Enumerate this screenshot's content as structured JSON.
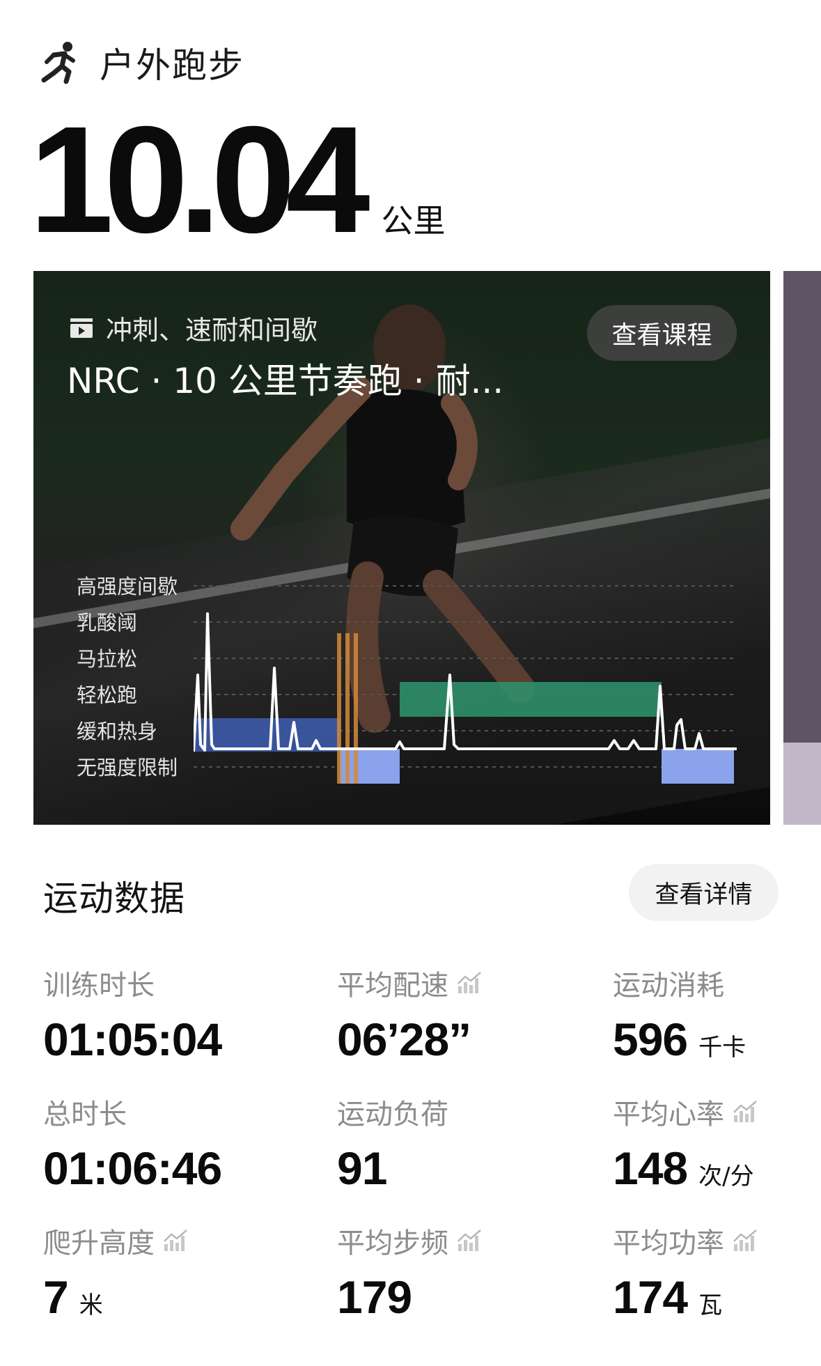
{
  "activity": {
    "icon": "running-icon",
    "title": "户外跑步"
  },
  "distance": {
    "value": "10.04",
    "unit": "公里"
  },
  "course": {
    "tag": "冲刺、速耐和间歇",
    "name": "NRC · 10 公里节奏跑 · 耐...",
    "view_button": "查看课程",
    "intensity_zones": [
      "高强度间歇",
      "乳酸阈",
      "马拉松",
      "轻松跑",
      "缓和热身",
      "无强度限制"
    ]
  },
  "stats": {
    "title": "运动数据",
    "details_button": "查看详情",
    "items": [
      {
        "label": "训练时长",
        "value": "01:05:04",
        "unit": "",
        "trend_icon": false
      },
      {
        "label": "平均配速",
        "value": "06’28”",
        "unit": "",
        "trend_icon": true
      },
      {
        "label": "运动消耗",
        "value": "596",
        "unit": "千卡",
        "trend_icon": false
      },
      {
        "label": "总时长",
        "value": "01:06:46",
        "unit": "",
        "trend_icon": false
      },
      {
        "label": "运动负荷",
        "value": "91",
        "unit": "",
        "trend_icon": false
      },
      {
        "label": "平均心率",
        "value": "148",
        "unit": "次/分",
        "trend_icon": true
      },
      {
        "label": "爬升高度",
        "value": "7",
        "unit": "米",
        "trend_icon": true
      },
      {
        "label": "平均步频",
        "value": "179",
        "unit": "",
        "trend_icon": true
      },
      {
        "label": "平均功率",
        "value": "174",
        "unit": "瓦",
        "trend_icon": true
      }
    ]
  },
  "colors": {
    "zone_blue": "#5b7fd9",
    "zone_green": "#2f8f6a",
    "zone_orange": "#d38a3a",
    "card_bg": "#1b2a1d"
  }
}
